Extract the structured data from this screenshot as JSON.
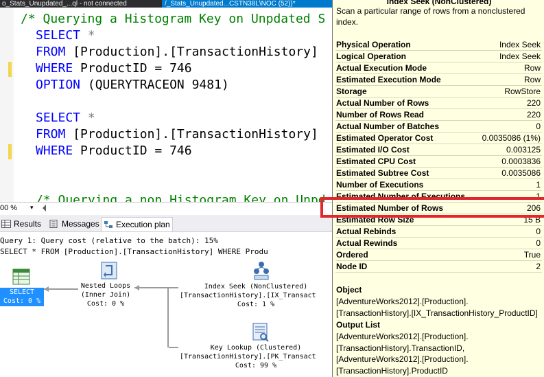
{
  "tabs": [
    {
      "label": "o_Stats_Unupdated_...ql - not connected"
    },
    {
      "label": "/_Stats_Unupdated...CSTN38L\\NOC (52))*"
    }
  ],
  "editor": {
    "line1": "/* Querying a Histogram Key on Unpdated S",
    "q1_select": "SELECT",
    "q1_star": "*",
    "q1_from": "FROM",
    "q1_table": "[Production].[TransactionHistory]",
    "q1_where": "WHERE",
    "q1_cond": "ProductID = 746",
    "q1_option": "OPTION",
    "q1_trace": "(QUERYTRACEON 9481)",
    "q2_select": "SELECT",
    "q2_star": "*",
    "q2_from": "FROM",
    "q2_table": "[Production].[TransactionHistory]",
    "q2_where": "WHERE",
    "q2_cond": "ProductID = 746",
    "line_last": "/* Querying a non Histogram Key on Unpd"
  },
  "zoom": {
    "value": "00 %"
  },
  "result_tabs": [
    {
      "label": "Results"
    },
    {
      "label": "Messages"
    },
    {
      "label": "Execution plan"
    }
  ],
  "plan": {
    "query_header": "Query 1: Query cost (relative to the batch): 15%",
    "query_text": "SELECT * FROM [Production].[TransactionHistory] WHERE Produ",
    "select_op": {
      "name": "SELECT",
      "cost": "Cost: 0 %"
    },
    "nested_loops": {
      "name": "Nested Loops",
      "sub": "(Inner Join)",
      "cost": "Cost: 0 %"
    },
    "index_seek": {
      "name": "Index Seek (NonClustered)",
      "object": "[TransactionHistory].[IX_Transact",
      "cost": "Cost: 1 %"
    },
    "key_lookup": {
      "name": "Key Lookup (Clustered)",
      "object": "[TransactionHistory].[PK_Transact",
      "cost": "Cost: 99 %"
    }
  },
  "tooltip": {
    "title": "Index Seek (NonClustered)",
    "description": "Scan a particular range of rows from a nonclustered index.",
    "rows": [
      {
        "label": "Physical Operation",
        "value": "Index Seek"
      },
      {
        "label": "Logical Operation",
        "value": "Index Seek"
      },
      {
        "label": "Actual Execution Mode",
        "value": "Row"
      },
      {
        "label": "Estimated Execution Mode",
        "value": "Row"
      },
      {
        "label": "Storage",
        "value": "RowStore"
      },
      {
        "label": "Actual Number of Rows",
        "value": "220"
      },
      {
        "label": "Number of Rows Read",
        "value": "220"
      },
      {
        "label": "Actual Number of Batches",
        "value": "0"
      },
      {
        "label": "Estimated Operator Cost",
        "value": "0.0035086 (1%)"
      },
      {
        "label": "Estimated I/O Cost",
        "value": "0.003125"
      },
      {
        "label": "Estimated CPU Cost",
        "value": "0.0003836"
      },
      {
        "label": "Estimated Subtree Cost",
        "value": "0.0035086"
      },
      {
        "label": "Number of Executions",
        "value": "1"
      },
      {
        "label": "Estimated Number of Executions",
        "value": "1"
      },
      {
        "label": "Estimated Number of Rows",
        "value": "206"
      },
      {
        "label": "Estimated Row Size",
        "value": "15 B"
      },
      {
        "label": "Actual Rebinds",
        "value": "0"
      },
      {
        "label": "Actual Rewinds",
        "value": "0"
      },
      {
        "label": "Ordered",
        "value": "True"
      },
      {
        "label": "Node ID",
        "value": "2"
      }
    ],
    "object_heading": "Object",
    "object_value": "[AdventureWorks2012].[Production].[TransactionHistory].[IX_TransactionHistory_ProductID]",
    "output_heading": "Output List",
    "output_lines": [
      "[AdventureWorks2012].[Production].",
      "[TransactionHistory].TransactionID,",
      "[AdventureWorks2012].[Production].",
      "[TransactionHistory].ProductID"
    ]
  },
  "colors": {
    "highlight": "#e3262e",
    "selection": "#1e90ff",
    "tooltip_bg": "#ffffe1"
  }
}
